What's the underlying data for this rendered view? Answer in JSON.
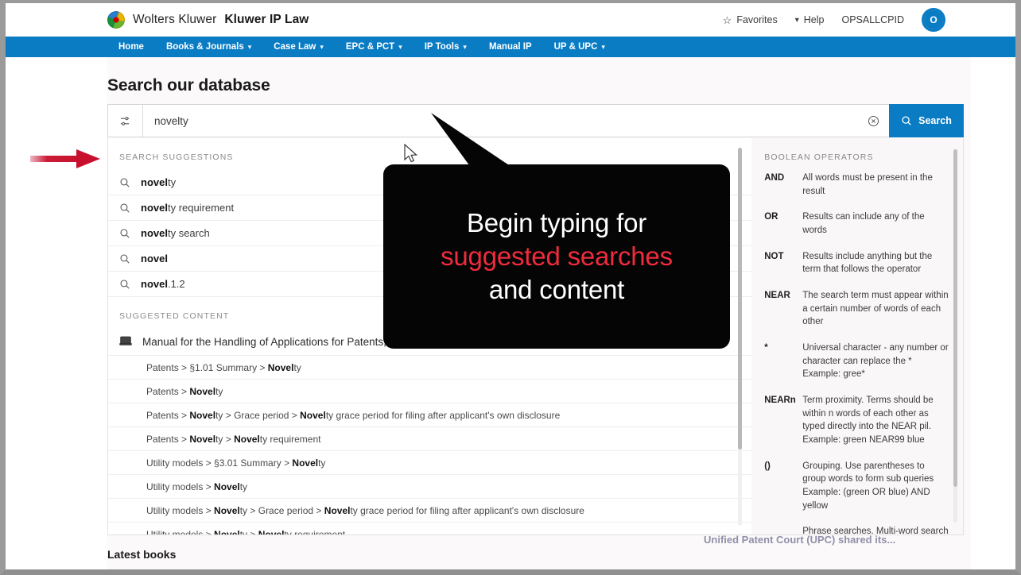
{
  "header": {
    "brand_main": "Wolters Kluwer",
    "brand_sub": "Kluwer IP Law",
    "favorites": "Favorites",
    "help": "Help",
    "user_id": "OPSALLCPID",
    "avatar_initial": "O",
    "accent_blue": "#0a7cc4"
  },
  "nav": {
    "items": [
      {
        "label": "Home",
        "caret": false
      },
      {
        "label": "Books & Journals",
        "caret": true
      },
      {
        "label": "Case Law",
        "caret": true
      },
      {
        "label": "EPC & PCT",
        "caret": true
      },
      {
        "label": "IP Tools",
        "caret": true
      },
      {
        "label": "Manual IP",
        "caret": false
      },
      {
        "label": "UP & UPC",
        "caret": true
      }
    ]
  },
  "main": {
    "page_title": "Search our database",
    "latest_books": "Latest books",
    "behind_news": "Unified Patent Court (UPC) shared its..."
  },
  "search": {
    "value": "novelty",
    "placeholder": "Search",
    "button_label": "Search",
    "filter_icon": "sliders-icon",
    "clear_icon": "clear-circle-icon",
    "search_icon": "magnifier-icon"
  },
  "suggestions": {
    "section_label": "SEARCH SUGGESTIONS",
    "items": [
      {
        "bold": "novel",
        "rest": "ty"
      },
      {
        "bold": "novel",
        "rest": "ty requirement"
      },
      {
        "bold": "novel",
        "rest": "ty search"
      },
      {
        "bold": "novel",
        "rest": ""
      },
      {
        "bold": "novel",
        "rest": ".1.2"
      }
    ]
  },
  "suggested_content": {
    "section_label": "SUGGESTED CONTENT",
    "doc_title": "Manual for the Handling of Applications for Patents,",
    "doc_icon": "book-icon",
    "rows": [
      "Patents > §1.01 Summary > <b>Novel</b>ty",
      "Patents > <b>Novel</b>ty",
      "Patents > <b>Novel</b>ty > Grace period > <b>Novel</b>ty grace period for filing after applicant's own disclosure",
      "Patents > <b>Novel</b>ty > <b>Novel</b>ty requirement",
      "Utility models > §3.01 Summary > <b>Novel</b>ty",
      "Utility models > <b>Novel</b>ty",
      "Utility models > <b>Novel</b>ty > Grace period > <b>Novel</b>ty grace period for filing after applicant's own disclosure",
      "Utility models > <b>Novel</b>ty > <b>Novel</b>ty requirement"
    ]
  },
  "boolean_panel": {
    "title": "BOOLEAN OPERATORS",
    "rows": [
      {
        "op": "AND",
        "desc": "All words must be present in the result"
      },
      {
        "op": "OR",
        "desc": "Results can include any of the words"
      },
      {
        "op": "NOT",
        "desc": "Results include anything but the term that follows the operator"
      },
      {
        "op": "NEAR",
        "desc": "The search term must appear within a certain number of words of each other"
      },
      {
        "op": "*",
        "desc": "Universal character - any number or character can replace the * Example: gree*"
      },
      {
        "op": "NEARn",
        "desc": "Term proximity. Terms should be within n words of each other as typed directly into the NEAR pil. Example: green NEAR99 blue"
      },
      {
        "op": "()",
        "desc": "Grouping. Use parentheses to group words to form sub queries Example: (green OR blue) AND yellow"
      },
      {
        "op": "",
        "desc": "Phrase searches. Multi-word search terms are treated as"
      }
    ]
  },
  "callout": {
    "line1": "Begin typing for",
    "line2": "suggested searches",
    "line3": "and content",
    "highlight_color": "#ef2b3d",
    "background": "#050505"
  },
  "annotations": {
    "red_arrow_color": "#c8102e",
    "cursor": "mouse-pointer"
  }
}
